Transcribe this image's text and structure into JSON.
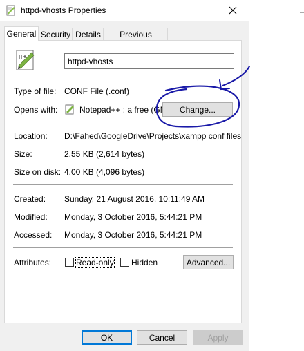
{
  "window": {
    "title": "httpd-vhosts Properties",
    "close_icon": "close-icon"
  },
  "tabs": [
    {
      "label": "General",
      "active": true
    },
    {
      "label": "Security"
    },
    {
      "label": "Details"
    },
    {
      "label": "Previous Versions"
    }
  ],
  "general": {
    "file_name": "httpd-vhosts",
    "type_of_file_label": "Type of file:",
    "type_of_file_value": "CONF File (.conf)",
    "opens_with_label": "Opens with:",
    "opens_with_value": "Notepad++ : a free (GN",
    "change_button": "Change...",
    "location_label": "Location:",
    "location_value": "D:\\Fahed\\GoogleDrive\\Projects\\xampp conf files",
    "size_label": "Size:",
    "size_value": "2.55 KB (2,614 bytes)",
    "size_on_disk_label": "Size on disk:",
    "size_on_disk_value": "4.00 KB (4,096 bytes)",
    "created_label": "Created:",
    "created_value": "Sunday, 21 August 2016, 10:11:49 AM",
    "modified_label": "Modified:",
    "modified_value": "Monday, 3 October 2016, 5:44:21 PM",
    "accessed_label": "Accessed:",
    "accessed_value": "Monday, 3 October 2016, 5:44:21 PM",
    "attributes_label": "Attributes:",
    "readonly_label": "Read-only",
    "hidden_label": "Hidden",
    "advanced_button": "Advanced..."
  },
  "footer": {
    "ok": "OK",
    "cancel": "Cancel",
    "apply": "Apply"
  },
  "colors": {
    "annotation": "#1a1aa8",
    "focus_border": "#0078d7"
  }
}
